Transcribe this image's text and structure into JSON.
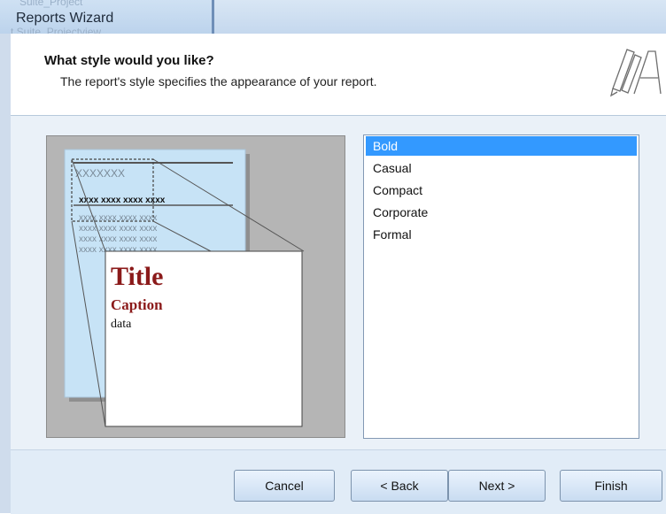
{
  "window": {
    "title": "Reports Wizard",
    "behind_text_top": "Suite_Project",
    "behind_text_bottom": "t Suite_Projectview"
  },
  "header": {
    "heading": "What style would you like?",
    "subtext": "The report's style specifies the appearance of your report."
  },
  "preview": {
    "title_text": "Title",
    "caption_text": "Caption",
    "data_text": "data",
    "placeholder_header": "XXXXXXX",
    "placeholder_row": "xxxx xxxx xxxx xxxx",
    "accent_color": "#8b1a1a"
  },
  "style_list": {
    "items": [
      "Bold",
      "Casual",
      "Compact",
      "Corporate",
      "Formal"
    ],
    "selected": "Bold"
  },
  "buttons": {
    "cancel": "Cancel",
    "back": "< Back",
    "next": "Next >",
    "finish": "Finish"
  }
}
